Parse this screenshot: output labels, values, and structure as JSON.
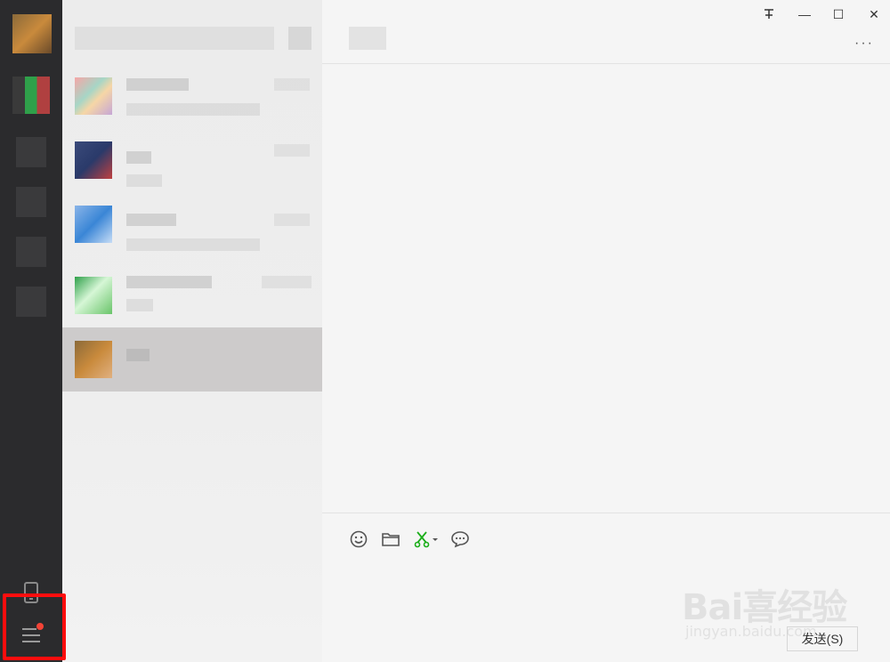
{
  "window": {
    "pin_icon": "pin-icon",
    "minimize_label": "—",
    "maximize_label": "☐",
    "close_label": "✕"
  },
  "chat": {
    "more_label": "···",
    "send_label": "发送(S)",
    "toolbar": [
      "emoji-icon",
      "folder-icon",
      "scissors-icon",
      "chat-bubble-icon"
    ]
  },
  "sidebar": {
    "phone_icon": "phone-icon",
    "menu_icon": "menu-icon",
    "notification_color": "#f44336"
  },
  "watermark": {
    "main": "Bai喜经验",
    "sub": "jingyan.baidu.com"
  },
  "colors": {
    "rail": "#2b2b2d",
    "list_bg": "#ececec",
    "selected_row": "#cdcbcb",
    "chat_bg": "#f5f5f5",
    "highlight": "#ff0d0d",
    "accent_green": "#1aad19"
  }
}
